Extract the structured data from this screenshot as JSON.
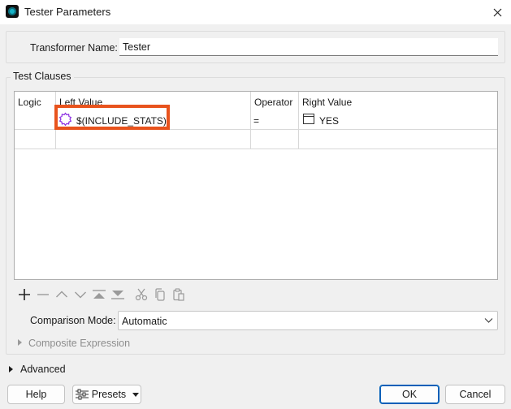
{
  "window": {
    "title": "Tester Parameters"
  },
  "transformer": {
    "label": "Transformer Name:",
    "value": "Tester"
  },
  "test_clauses": {
    "group_label": "Test Clauses",
    "columns": [
      "Logic",
      "Left Value",
      "Operator",
      "Right Value"
    ],
    "rows": [
      {
        "logic": "",
        "left_value": "$(INCLUDE_STATS)",
        "left_icon": "user-parameter-icon",
        "operator": "=",
        "right_value": "YES",
        "right_icon": "text-value-icon"
      },
      {
        "logic": "",
        "left_value": "",
        "operator": "",
        "right_value": ""
      }
    ]
  },
  "toolbar": {
    "icons": [
      "add-icon",
      "remove-icon",
      "move-up-icon",
      "move-down-icon",
      "move-to-top-icon",
      "move-to-bottom-icon",
      "cut-icon",
      "copy-icon",
      "paste-icon"
    ]
  },
  "comparison": {
    "label": "Comparison Mode:",
    "value": "Automatic"
  },
  "composite": {
    "label": "Composite Expression"
  },
  "advanced": {
    "label": "Advanced"
  },
  "buttons": {
    "help": "Help",
    "presets": "Presets",
    "ok": "OK",
    "cancel": "Cancel"
  },
  "colors": {
    "highlight": "#e8531d",
    "primary_border": "#005fb8",
    "param_icon": "#8a2be2"
  }
}
